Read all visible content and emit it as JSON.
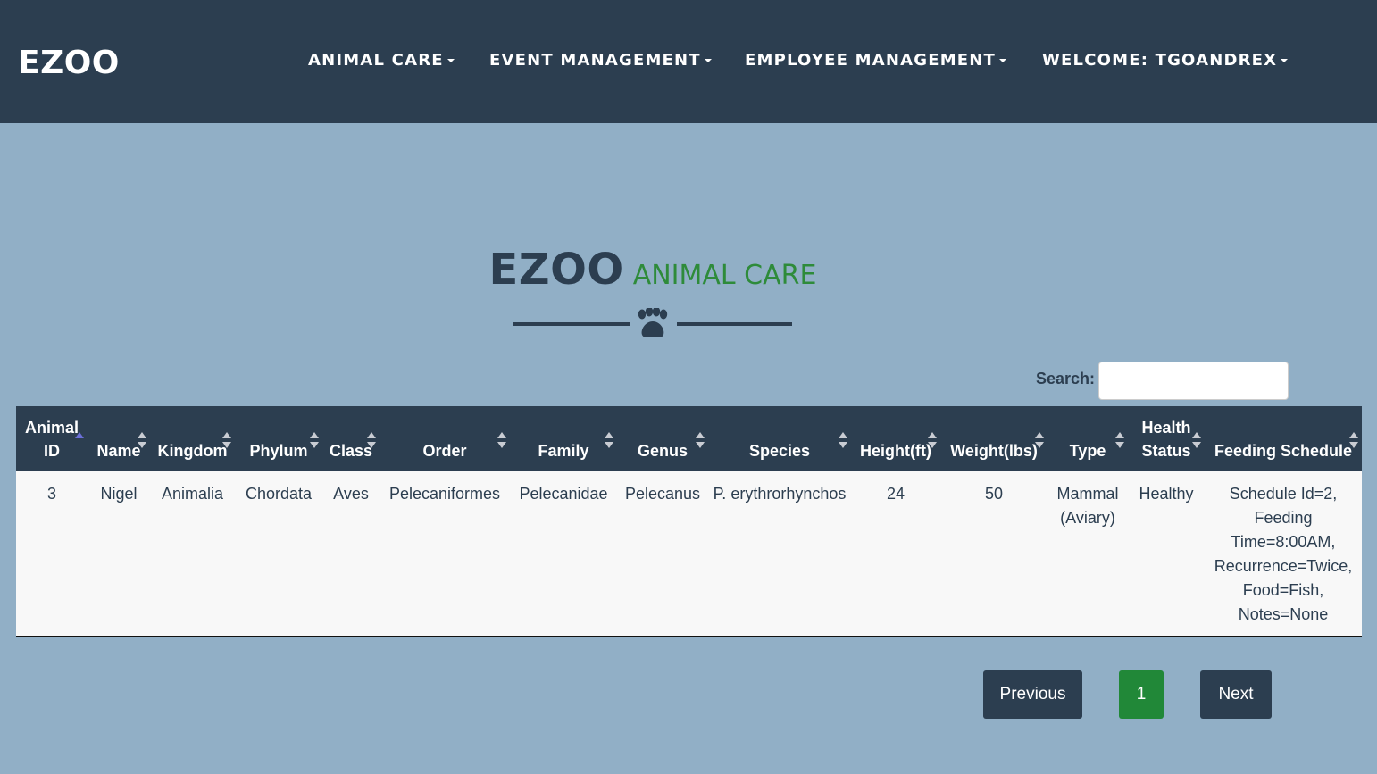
{
  "navbar": {
    "brand": "EZOO",
    "items": [
      {
        "label": "ANIMAL CARE"
      },
      {
        "label": "EVENT MANAGEMENT"
      },
      {
        "label": "EMPLOYEE MANAGEMENT"
      },
      {
        "label": "WELCOME: TGOANDREX"
      }
    ]
  },
  "heading": {
    "title": "EZOO",
    "subtitle": "ANIMAL CARE",
    "icon": "paw-icon"
  },
  "search": {
    "label": "Search:",
    "value": "",
    "placeholder": ""
  },
  "table": {
    "columns": [
      {
        "line1": "Animal",
        "line2": "ID"
      },
      {
        "line1": "",
        "line2": "Name"
      },
      {
        "line1": "",
        "line2": "Kingdom"
      },
      {
        "line1": "",
        "line2": "Phylum"
      },
      {
        "line1": "",
        "line2": "Class"
      },
      {
        "line1": "",
        "line2": "Order"
      },
      {
        "line1": "",
        "line2": "Family"
      },
      {
        "line1": "",
        "line2": "Genus"
      },
      {
        "line1": "",
        "line2": "Species"
      },
      {
        "line1": "",
        "line2": "Height(ft)"
      },
      {
        "line1": "",
        "line2": "Weight(lbs)"
      },
      {
        "line1": "",
        "line2": "Type"
      },
      {
        "line1": "Health",
        "line2": "Status"
      },
      {
        "line1": "",
        "line2": "Feeding Schedule"
      }
    ],
    "rows": [
      {
        "cells": [
          "3",
          "Nigel",
          "Animalia",
          "Chordata",
          "Aves",
          "Pelecaniformes",
          "Pelecanidae",
          "Pelecanus",
          "P. erythrorhynchos",
          "24",
          "50",
          "Mammal (Aviary)",
          "Healthy",
          "Schedule Id=2, Feeding Time=8:00AM, Recurrence=Twice, Food=Fish, Notes=None"
        ]
      }
    ]
  },
  "pagination": {
    "previous": "Previous",
    "current_page": "1",
    "next": "Next"
  },
  "colors": {
    "navbar": "#2c3e50",
    "background": "#91afc6",
    "accent_green": "#2e8b3a",
    "page_active": "#218838"
  }
}
